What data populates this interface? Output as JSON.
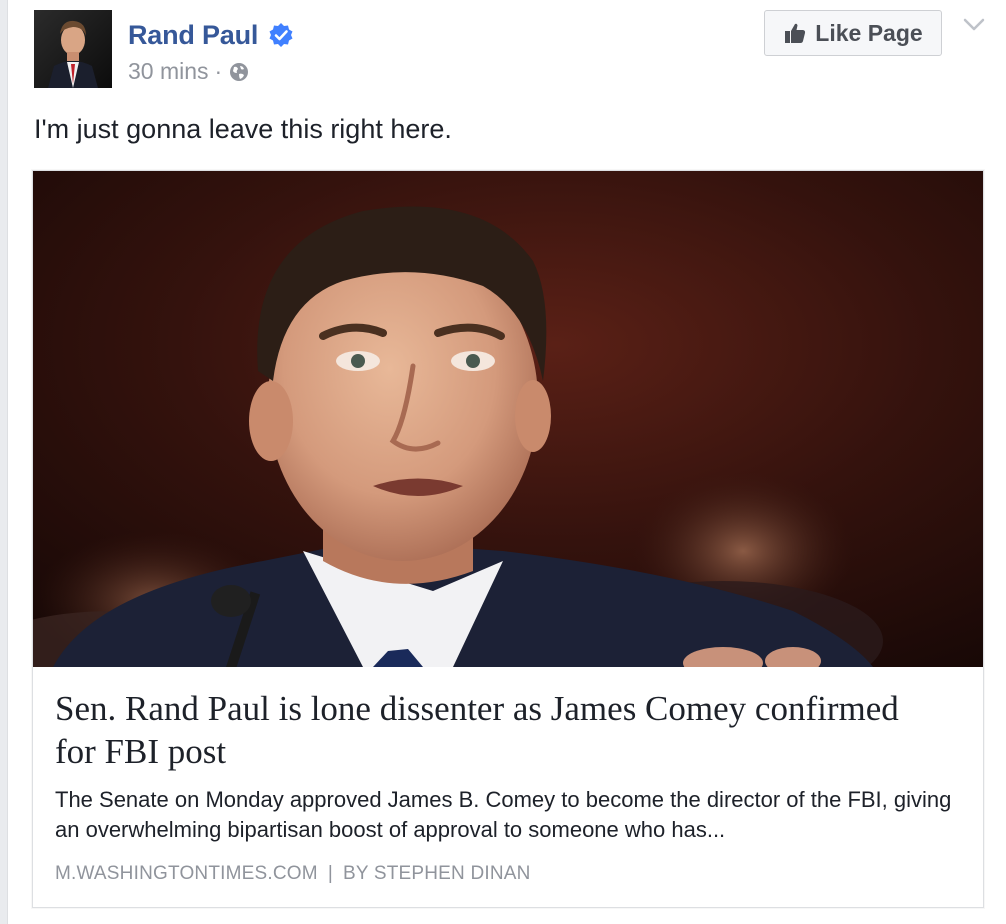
{
  "post": {
    "author": "Rand Paul",
    "verified": true,
    "timestamp": "30 mins",
    "separator": "·",
    "privacy_icon": "globe-icon",
    "text": "I'm just gonna leave this right here.",
    "like_page_label": "Like Page",
    "like_icon": "thumbs-up-icon",
    "menu_icon": "chevron-down-icon"
  },
  "link": {
    "title": "Sen. Rand Paul is lone dissenter as James Comey confirmed for FBI post",
    "description": "The Senate on Monday approved James B. Comey to become the director of the FBI, giving an overwhelming bipartisan boost of approval to someone who has...",
    "domain": "M.WASHINGTONTIMES.COM",
    "divider": "|",
    "byline": "BY STEPHEN DINAN"
  },
  "colors": {
    "name_blue": "#365899",
    "meta_gray": "#90949c",
    "verified_blue": "#4080ff",
    "text": "#1d2129"
  }
}
